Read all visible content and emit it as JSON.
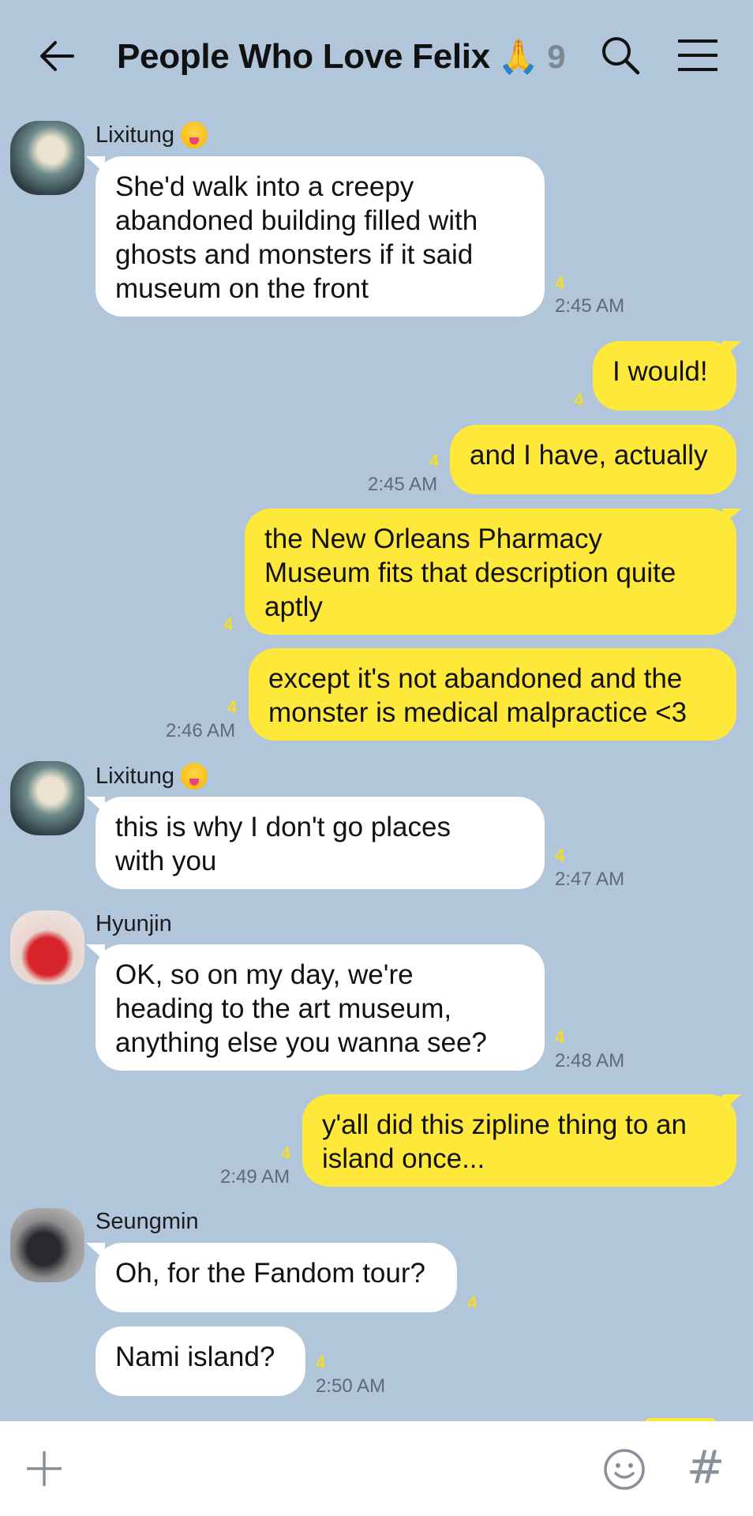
{
  "header": {
    "title": "People Who Love Felix",
    "title_emoji": "🙏",
    "member_count": "9",
    "back_icon": "arrow-left-icon",
    "search_icon": "search-icon",
    "menu_icon": "hamburger-menu-icon"
  },
  "messages": {
    "m1": {
      "sender": "Lixitung",
      "text_lines": [
        "She'd walk into a creepy",
        "abandoned building filled with",
        "ghosts and monsters if it said",
        "museum on the front"
      ],
      "unread": "4",
      "time": "2:45 AM"
    },
    "m2": {
      "text": "I would!",
      "unread": "4"
    },
    "m3": {
      "text": "and I have, actually",
      "unread": "4",
      "time": "2:45 AM"
    },
    "m4": {
      "text_lines": [
        "the New Orleans Pharmacy",
        "Museum fits that description quite",
        "aptly"
      ],
      "unread": "4"
    },
    "m5": {
      "text_lines": [
        "except it's not abandoned and the",
        "monster is medical malpractice <3"
      ],
      "unread": "4",
      "time": "2:46 AM"
    },
    "m6": {
      "sender": "Lixitung",
      "text_lines": [
        "this is why I don't go places",
        "with you"
      ],
      "unread": "4",
      "time": "2:47 AM"
    },
    "m7": {
      "sender": "Hyunjin",
      "text_lines": [
        "OK, so on my day, we're",
        "heading to the art museum,",
        "anything else you wanna see?"
      ],
      "unread": "4",
      "time": "2:48 AM"
    },
    "m8": {
      "text_lines": [
        "y'all did this zipline thing to an",
        "island once..."
      ],
      "unread": "4",
      "time": "2:49 AM"
    },
    "m9": {
      "sender": "Seungmin",
      "text": "Oh, for the Fandom tour?",
      "unread": "4"
    },
    "m10": {
      "text": "Nami island?",
      "unread": "4",
      "time": "2:50 AM"
    }
  },
  "input_bar": {
    "plus_icon": "plus-icon",
    "emoji_icon": "smiley-icon",
    "hash_label": "#"
  },
  "colors": {
    "background": "#b1c5db",
    "incoming_bubble": "#ffffff",
    "outgoing_bubble": "#fee93a",
    "unread_count": "#f3dd2a",
    "timestamp": "#5e6a78"
  }
}
